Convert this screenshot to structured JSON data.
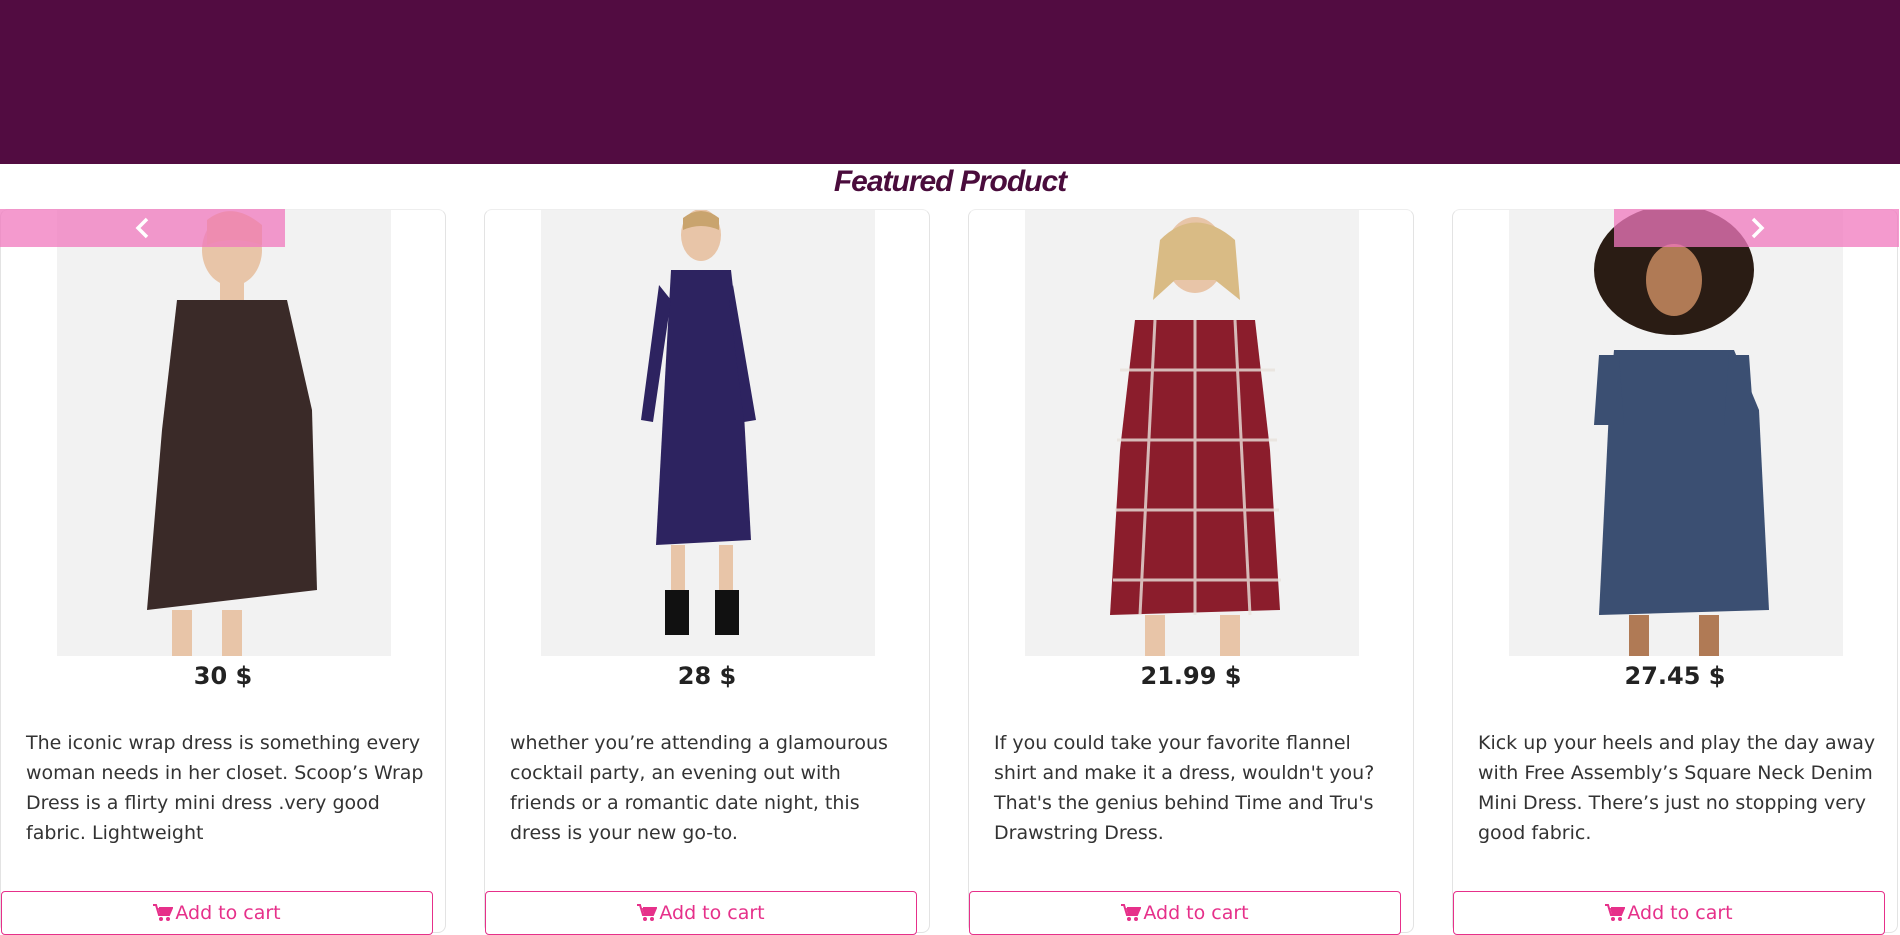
{
  "section": {
    "title": "Featured Product"
  },
  "colors": {
    "banner": "#520c41",
    "accent": "#e6308a",
    "nav_overlay": "#f078be"
  },
  "carousel": {
    "prev_icon": "chevron-left-icon",
    "next_icon": "chevron-right-icon"
  },
  "products": [
    {
      "price": "30 $",
      "description": "The iconic wrap dress is something every woman needs in her closet. Scoop’s Wrap Dress is a flirty mini dress .very good fabric. Lightweight",
      "cart_label": "Add to cart",
      "cart_icon": "shopping-cart-icon",
      "dress_color": "#3a2a28"
    },
    {
      "price": "28 $",
      "description": "whether you’re attending a glamourous cocktail party, an evening out with friends or a romantic date night, this dress is your new go-to.",
      "cart_label": "Add to cart",
      "cart_icon": "shopping-cart-icon",
      "dress_color": "#2d2360"
    },
    {
      "price": "21.99 $",
      "description": "If you could take your favorite flannel shirt and make it a dress, wouldn't you? That's the genius behind Time and Tru's Drawstring Dress.",
      "cart_label": "Add to cart",
      "cart_icon": "shopping-cart-icon",
      "dress_color": "#8b1d2c"
    },
    {
      "price": "27.45 $",
      "description": "Kick up your heels and play the day away with Free Assembly’s Square Neck Denim Mini Dress. There’s just no stopping very good fabric.",
      "cart_label": "Add to cart",
      "cart_icon": "shopping-cart-icon",
      "dress_color": "#3b4f72"
    }
  ]
}
